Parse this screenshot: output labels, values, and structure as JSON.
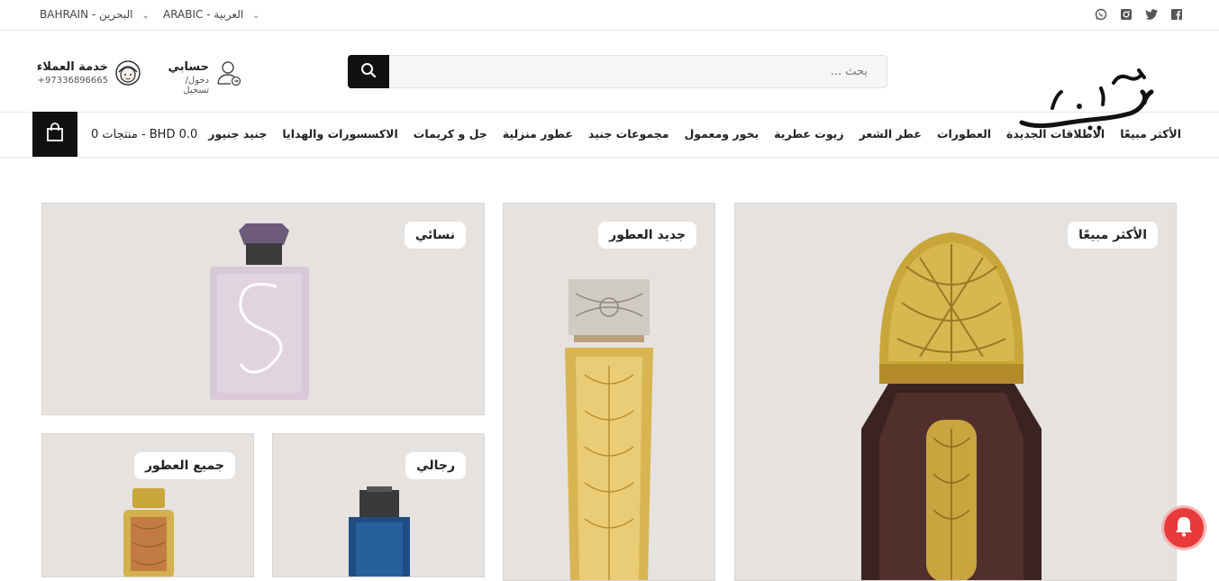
{
  "topbar": {
    "country": "BAHRAIN - البحرين",
    "language": "ARABIC - العربية",
    "social_icons": [
      "whatsapp-icon",
      "instagram-icon",
      "twitter-icon",
      "facebook-icon"
    ]
  },
  "header": {
    "customer_service": {
      "title": "خدمة العملاء",
      "phone": "+97336896665"
    },
    "account": {
      "title": "حسابي",
      "subtitle": "دخول/ تسجيل"
    },
    "search": {
      "placeholder": "بحث ..."
    },
    "logo_text": "جنيد"
  },
  "nav": {
    "cart": "0 منتجات - BHD 0.0",
    "items": [
      "الأكثر مبيعًا",
      "الاطلاقات الجديدة",
      "العطورات",
      "عطر الشعر",
      "زيوت عطرية",
      "بخور ومعمول",
      "مجموعات جنيد",
      "عطور منزلية",
      "جل و كريمات",
      "الاكسسورات والهدايا",
      "جنيد جنيور"
    ]
  },
  "tiles": {
    "bestseller": "الأكثر مبيعًا",
    "new": "جديد العطور",
    "women": "نسائي",
    "men": "رجالي",
    "all": "جميع العطور"
  },
  "colors": {
    "accent": "#111111",
    "tile_bg": "#e5e2e0",
    "notification": "#e8393b"
  }
}
